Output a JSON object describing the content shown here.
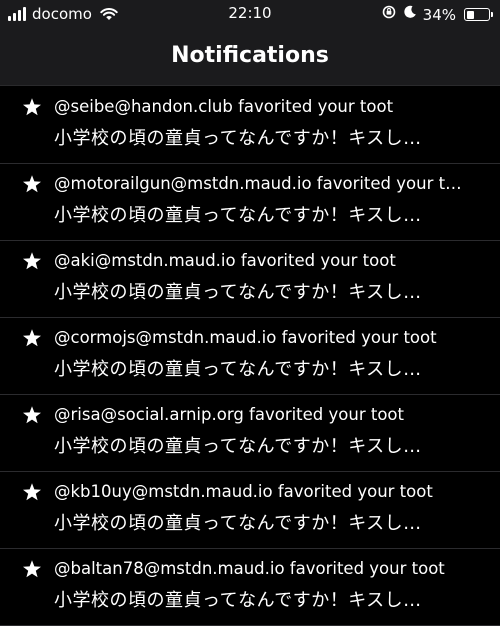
{
  "status_bar": {
    "carrier": "docomo",
    "time": "22:10",
    "battery_percent": "34%",
    "battery_level": 0.34,
    "icons": [
      "signal-bars-icon",
      "wifi-icon",
      "orientation-lock-icon",
      "moon-icon",
      "battery-icon"
    ]
  },
  "nav": {
    "title": "Notifications"
  },
  "notifications": [
    {
      "title": "@seibe@handon.club favorited your toot",
      "body": "小学校の頃の童貞ってなんですか！キスし…",
      "icon": "star-icon"
    },
    {
      "title": "@motorailgun@mstdn.maud.io favorited your t…",
      "body": "小学校の頃の童貞ってなんですか！キスし…",
      "icon": "star-icon"
    },
    {
      "title": "@aki@mstdn.maud.io favorited your toot",
      "body": "小学校の頃の童貞ってなんですか！キスし…",
      "icon": "star-icon"
    },
    {
      "title": "@cormojs@mstdn.maud.io favorited your toot",
      "body": "小学校の頃の童貞ってなんですか！キスし…",
      "icon": "star-icon"
    },
    {
      "title": "@risa@social.arnip.org favorited your toot",
      "body": "小学校の頃の童貞ってなんですか！キスし…",
      "icon": "star-icon"
    },
    {
      "title": "@kb10uy@mstdn.maud.io favorited your toot",
      "body": "小学校の頃の童貞ってなんですか！キスし…",
      "icon": "star-icon"
    },
    {
      "title": "@baltan78@mstdn.maud.io favorited your toot",
      "body": "小学校の頃の童貞ってなんですか！キスし…",
      "icon": "star-icon"
    }
  ],
  "colors": {
    "background": "#000000",
    "bar": "#1b1b1d",
    "separator": "#2b2b2e",
    "text": "#ffffff"
  }
}
